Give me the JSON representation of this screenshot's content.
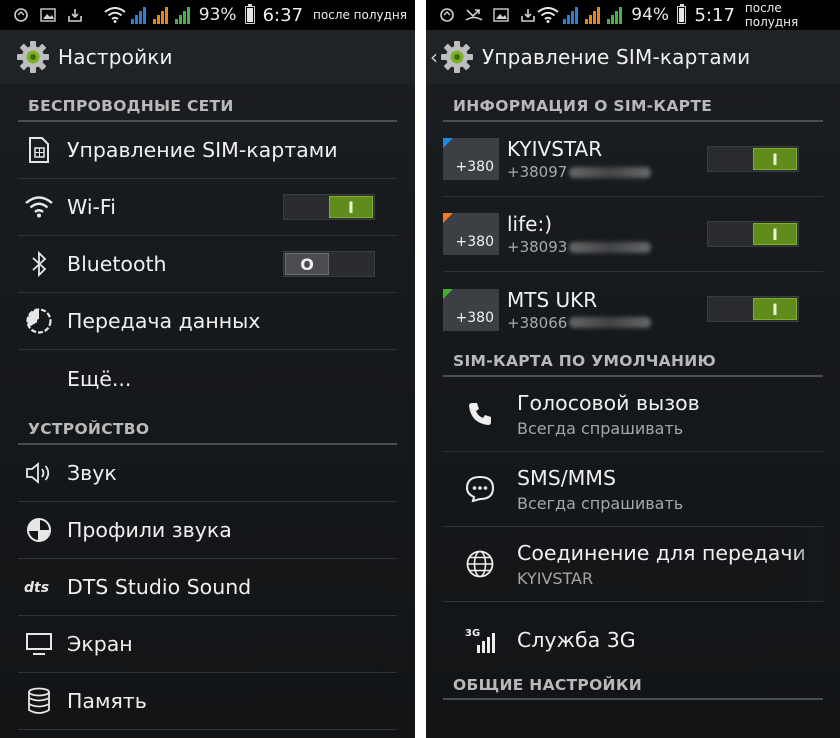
{
  "colors": {
    "accent_green": "#5f8c1c",
    "blue_corner": "#1e88e5",
    "orange_corner": "#f47b20",
    "green_corner": "#43b02a",
    "signal_blue": "#2c7fd1",
    "signal_orange": "#e08a1e",
    "signal_green": "#4caf50"
  },
  "left": {
    "status": {
      "battery": "93%",
      "time": "6:37",
      "ampm": "после полудня"
    },
    "title": "Настройки",
    "sections": {
      "wireless": "БЕСПРОВОДНЫЕ СЕТИ",
      "device": "УСТРОЙСТВО"
    },
    "items": {
      "sim": "Управление SIM-картами",
      "wifi": "Wi-Fi",
      "bluetooth": "Bluetooth",
      "data": "Передача данных",
      "more": "Ещё...",
      "sound": "Звук",
      "profiles": "Профили звука",
      "dts": "DTS Studio Sound",
      "display": "Экран",
      "storage": "Память"
    },
    "toggles": {
      "wifi": "I",
      "bluetooth": "O"
    }
  },
  "right": {
    "status": {
      "battery": "94%",
      "time": "5:17",
      "ampm": "после полудня"
    },
    "title": "Управление SIM-картами",
    "sections": {
      "info": "ИНФОРМАЦИЯ О SIM-КАРТЕ",
      "default": "SIM-КАРТА ПО УМОЛЧАНИЮ",
      "general": "ОБЩИЕ НАСТРОЙКИ"
    },
    "sims": [
      {
        "code": "+380",
        "name": "KYIVSTAR",
        "number": "+38097",
        "toggle": "I"
      },
      {
        "code": "+380",
        "name": "life:)",
        "number": "+38093",
        "toggle": "I"
      },
      {
        "code": "+380",
        "name": "MTS UKR",
        "number": "+38066",
        "toggle": "I"
      }
    ],
    "defaults": {
      "voice": {
        "title": "Голосовой вызов",
        "sub": "Всегда спрашивать"
      },
      "sms": {
        "title": "SMS/MMS",
        "sub": "Всегда спрашивать"
      },
      "data": {
        "title": "Соединение для передачи",
        "sub": "KYIVSTAR"
      },
      "service3g": {
        "title": "Служба 3G",
        "icon_label": "3G"
      }
    }
  }
}
